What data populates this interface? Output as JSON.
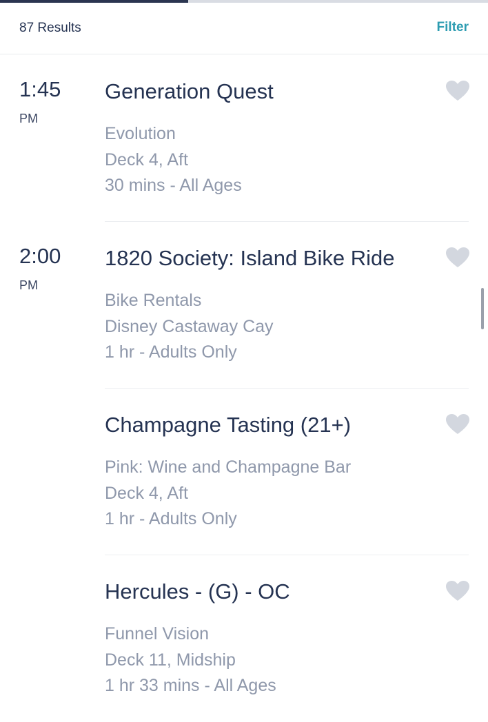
{
  "header": {
    "results_count": "87 Results",
    "filter_label": "Filter",
    "progress_fraction": 0.385
  },
  "colors": {
    "accent": "#2d9cb1",
    "title_text": "#253352",
    "detail_text": "#8f98ab",
    "heart_icon": "#d3d7df"
  },
  "events": [
    {
      "time": "1:45",
      "ampm": "PM",
      "title": "Generation Quest",
      "location": "Evolution",
      "deck": "Deck 4, Aft",
      "duration": "30 mins - All Ages",
      "icon": "heart-icon"
    },
    {
      "time": "2:00",
      "ampm": "PM",
      "title": "1820 Society: Island Bike Ride",
      "location": "Bike Rentals",
      "deck": "Disney Castaway Cay",
      "duration": "1 hr - Adults Only",
      "icon": "heart-icon"
    },
    {
      "time": "",
      "ampm": "",
      "title": "Champagne Tasting (21+)",
      "location": "Pink: Wine and Champagne Bar",
      "deck": "Deck 4, Aft",
      "duration": "1 hr - Adults Only",
      "icon": "heart-icon"
    },
    {
      "time": "",
      "ampm": "",
      "title": "Hercules - (G) - OC",
      "location": "Funnel Vision",
      "deck": "Deck 11, Midship",
      "duration": "1 hr 33 mins - All Ages",
      "icon": "heart-icon"
    }
  ]
}
